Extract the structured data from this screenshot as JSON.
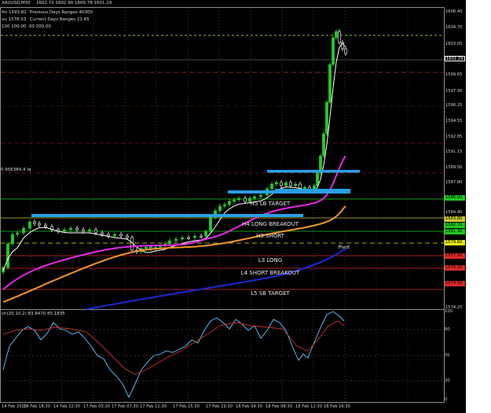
{
  "header": {
    "symbol": "XAUUSD,M30",
    "ohlc": "1602.72  1602.90  1600.78  1601.29",
    "row1_left": "fm  1593.81",
    "row1_right": "Previous Days Ranges 40300",
    "row2_left": "vu  1578.03",
    "row2_right": "Current Days Ranges 21.65",
    "row3": "100 100.00  .00 200.00"
  },
  "left_label": "0.956384.4 lq",
  "level_labels": {
    "h5": "H5 LB TARGET",
    "h4": "H4 LONG BREAKOUT",
    "h3": "H3 SHORT",
    "pivot": "Pivot",
    "l3": "L3 LONG",
    "l4": "L4 SHORT BREAKOUT",
    "l5": "L5 SB TARGET"
  },
  "price_axis": [
    {
      "text": "1606.40",
      "bg": ""
    },
    {
      "text": "1604.70",
      "bg": ""
    },
    {
      "text": "1603.05",
      "bg": ""
    },
    {
      "text": "1601.29",
      "bg": "#000000"
    },
    {
      "text": "1599.65",
      "bg": ""
    },
    {
      "text": "1597.95",
      "bg": ""
    },
    {
      "text": "1596.25",
      "bg": ""
    },
    {
      "text": "1594.55",
      "bg": ""
    },
    {
      "text": "1592.85",
      "bg": ""
    },
    {
      "text": "1591.15",
      "bg": ""
    },
    {
      "text": "1589.50",
      "bg": ""
    },
    {
      "text": "1587.80",
      "bg": ""
    },
    {
      "text": "1586.00",
      "bg": "#1ec81e"
    },
    {
      "text": "1584.40",
      "bg": ""
    },
    {
      "text": "1583.80",
      "bg": "#c8c832"
    },
    {
      "text": "1582.70",
      "bg": "#1ec81e"
    },
    {
      "text": "1581.30",
      "bg": "#1ec81e"
    },
    {
      "text": "1579.60",
      "bg": "#e6e614"
    },
    {
      "text": "1577.90",
      "bg": "#dc2828"
    },
    {
      "text": "1576.20",
      "bg": "#dc2828"
    },
    {
      "text": "1574.50",
      "bg": "#dc2828"
    },
    {
      "text": "1574.25",
      "bg": ""
    }
  ],
  "oscillator": {
    "title": "ch(20,10,2) 83.8470 85.1835",
    "axis": [
      "100",
      "80",
      "50",
      "20",
      "0"
    ]
  },
  "time_axis": [
    "14 Feb 2020",
    "14 Feb 18:30",
    "14 Feb 22:30",
    "17 Feb 03:30",
    "17 Feb 07:30",
    "17 Feb 11:30",
    "17 Feb 15:30",
    "17 Feb 19:30",
    "18 Feb 04:30",
    "18 Feb 08:30",
    "18 Feb 12:30",
    "18 Feb 16:30"
  ],
  "colors": {
    "background": "#000000",
    "bull": "#28c828",
    "bear": "#ffffff",
    "ma_magenta": "#e628e6",
    "ma_orange": "#f09628",
    "ma_blue": "#1e28d2",
    "zone": "#28a0e6"
  }
}
